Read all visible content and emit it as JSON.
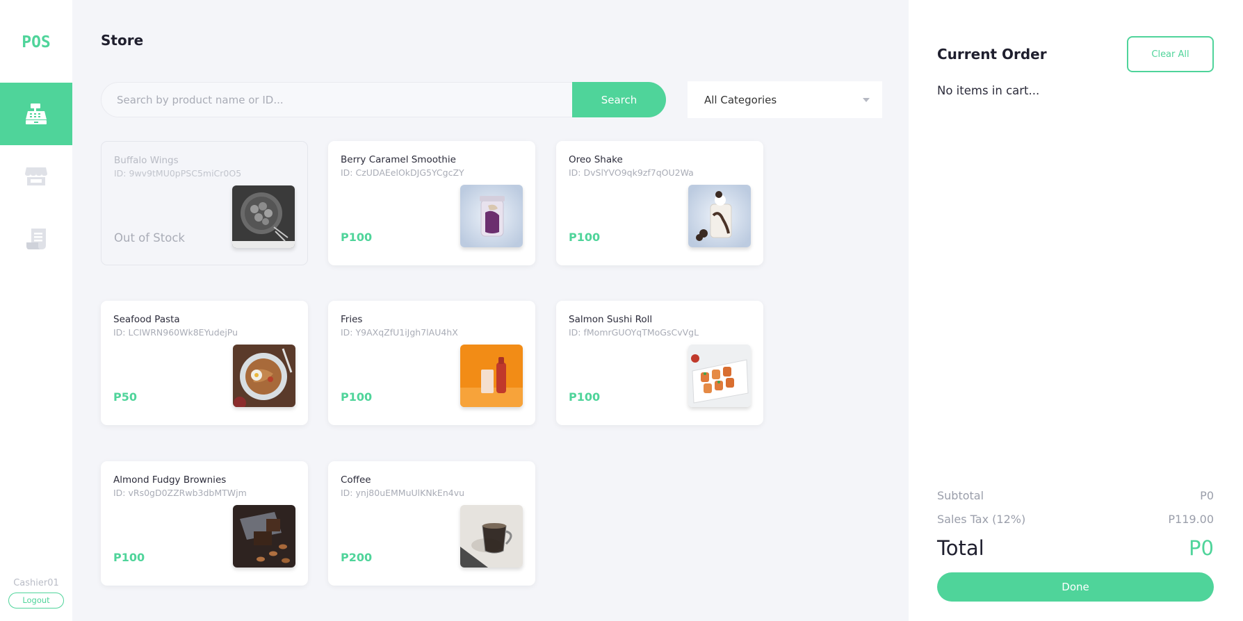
{
  "app": {
    "logo": "POS",
    "page_title": "Store"
  },
  "sidebar": {
    "items": [
      {
        "name": "cash-register-icon",
        "active": true
      },
      {
        "name": "store-icon",
        "active": false
      },
      {
        "name": "receipt-icon",
        "active": false
      }
    ],
    "user": "Cashier01",
    "logout_label": "Logout"
  },
  "search": {
    "placeholder": "Search by product name or ID...",
    "button_label": "Search"
  },
  "category": {
    "selected": "All Categories"
  },
  "products": [
    {
      "name": "Buffalo Wings",
      "id": "ID: 9wv9tMU0pPSC5miCr0O5",
      "price": "Out of Stock",
      "out_of_stock": true
    },
    {
      "name": "Berry Caramel Smoothie",
      "id": "ID: CzUDAEelOkDJG5YCgcZY",
      "price": "P100",
      "out_of_stock": false
    },
    {
      "name": "Oreo Shake",
      "id": "ID: DvSlYVO9qk9zf7qOU2Wa",
      "price": "P100",
      "out_of_stock": false
    },
    {
      "name": "Seafood Pasta",
      "id": "ID: LCIWRN960Wk8EYudejPu",
      "price": "P50",
      "out_of_stock": false
    },
    {
      "name": "Fries",
      "id": "ID: Y9AXqZfU1iJgh7lAU4hX",
      "price": "P100",
      "out_of_stock": false
    },
    {
      "name": "Salmon Sushi Roll",
      "id": "ID: fMomrGUOYqTMoGsCvVgL",
      "price": "P100",
      "out_of_stock": false
    },
    {
      "name": "Almond Fudgy Brownies",
      "id": "ID: vRs0gD0ZZRwb3dbMTWjm",
      "price": "P100",
      "out_of_stock": false
    },
    {
      "name": "Coffee",
      "id": "ID: ynj80uEMMuUlKNkEn4vu",
      "price": "P200",
      "out_of_stock": false
    }
  ],
  "order": {
    "title": "Current Order",
    "clear_label": "Clear All",
    "empty_message": "No items in cart...",
    "subtotal_label": "Subtotal",
    "subtotal_value": "P0",
    "tax_label": "Sales Tax (12%)",
    "tax_value": "P119.00",
    "total_label": "Total",
    "total_value": "P0",
    "done_label": "Done"
  },
  "colors": {
    "accent": "#4fd49a",
    "background": "#f4f5f9",
    "text": "#1f1f2e",
    "muted": "#a9acb6"
  }
}
